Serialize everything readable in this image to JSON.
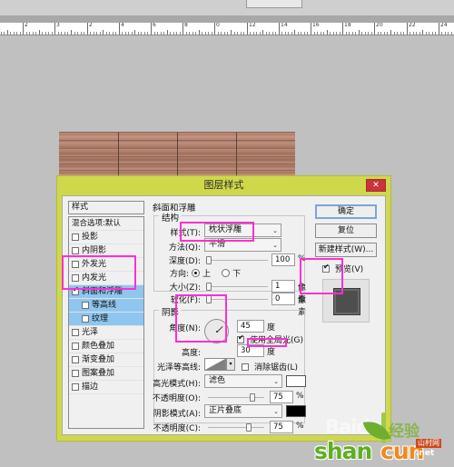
{
  "ruler": {
    "unit_labels": [
      "2",
      "3",
      "2",
      "4",
      "6",
      "8",
      "10",
      "12",
      "14",
      "16",
      "18",
      "20",
      "22",
      "24"
    ],
    "labels": [
      "2",
      "3",
      "2",
      "4",
      "6",
      "8",
      "0",
      "12",
      "14",
      "16",
      "18",
      "20",
      "22",
      "24"
    ]
  },
  "dialog": {
    "title": "图层样式",
    "close_label": "✕"
  },
  "styles_panel": {
    "header": "样式",
    "items": [
      {
        "label": "混合选项:默认",
        "checkbox": false,
        "checked": false,
        "selected": false,
        "sub": false
      },
      {
        "label": "投影",
        "checkbox": true,
        "checked": false,
        "selected": false,
        "sub": false
      },
      {
        "label": "内阴影",
        "checkbox": true,
        "checked": false,
        "selected": false,
        "sub": false
      },
      {
        "label": "外发光",
        "checkbox": true,
        "checked": false,
        "selected": false,
        "sub": false
      },
      {
        "label": "内发光",
        "checkbox": true,
        "checked": false,
        "selected": false,
        "sub": false
      },
      {
        "label": "斜面和浮雕",
        "checkbox": true,
        "checked": true,
        "selected": true,
        "sub": false
      },
      {
        "label": "等高线",
        "checkbox": true,
        "checked": false,
        "selected": true,
        "sub": true
      },
      {
        "label": "纹理",
        "checkbox": true,
        "checked": false,
        "selected": true,
        "sub": true
      },
      {
        "label": "光泽",
        "checkbox": true,
        "checked": false,
        "selected": false,
        "sub": false
      },
      {
        "label": "颜色叠加",
        "checkbox": true,
        "checked": false,
        "selected": false,
        "sub": false
      },
      {
        "label": "渐变叠加",
        "checkbox": true,
        "checked": false,
        "selected": false,
        "sub": false
      },
      {
        "label": "图案叠加",
        "checkbox": true,
        "checked": false,
        "selected": false,
        "sub": false
      },
      {
        "label": "描边",
        "checkbox": true,
        "checked": false,
        "selected": false,
        "sub": false
      }
    ]
  },
  "main": {
    "section_title": "斜面和浮雕",
    "structure": {
      "title": "结构",
      "style_label": "样式(T):",
      "style_value": "枕状浮雕",
      "technique_label": "方法(Q):",
      "technique_value": "平滑",
      "depth_label": "深度(D):",
      "depth_value": "100",
      "depth_unit": "%",
      "direction_label": "方向:",
      "direction_up": "上",
      "direction_down": "下",
      "size_label": "大小(Z):",
      "size_value": "1",
      "size_unit": "像素",
      "soften_label": "软化(F):",
      "soften_value": "0",
      "soften_unit": "像素"
    },
    "shading": {
      "title": "阴影",
      "angle_label": "角度(N):",
      "angle_value": "45",
      "angle_unit": "度",
      "global_light_label": "使用全局光(G)",
      "global_light_checked": true,
      "altitude_label": "高度:",
      "altitude_value": "30",
      "altitude_unit": "度",
      "gloss_contour_label": "光泽等高线:",
      "anti_alias_label": "消除锯齿(L)",
      "anti_alias_checked": false,
      "highlight_mode_label": "高光模式(H):",
      "highlight_mode_value": "滤色",
      "highlight_color": "#ffffff",
      "highlight_opacity_label": "不透明度(O):",
      "highlight_opacity_value": "75",
      "highlight_opacity_unit": "%",
      "shadow_mode_label": "阴影模式(A):",
      "shadow_mode_value": "正片叠底",
      "shadow_color": "#000000",
      "shadow_opacity_label": "不透明度(C):",
      "shadow_opacity_value": "75",
      "shadow_opacity_unit": "%"
    }
  },
  "buttons": {
    "ok": "确定",
    "reset": "复位",
    "new_style": "新建样式(W)...",
    "preview_label": "预览(V)",
    "preview_checked": true
  },
  "watermark": {
    "baidu": "Baidu",
    "jingyan": "经验",
    "shan": "shan",
    "cun": "cun",
    "cn": "山村网",
    "net": ".net"
  },
  "colors": {
    "dialog_frame": "#cfd84b",
    "highlight_box": "#ff2fd0",
    "selection": "#8ec6f0",
    "close_button": "#c8343c"
  }
}
